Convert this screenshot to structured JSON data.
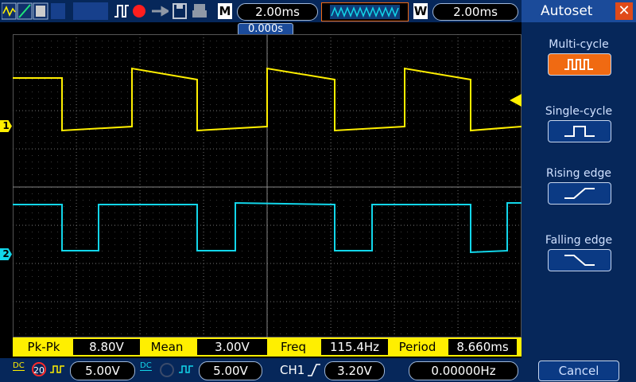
{
  "topbar": {
    "timebase_tag": "M",
    "timebase": "2.00ms",
    "window_tag": "W",
    "window": "2.00ms",
    "trigger_offset": "0.000s"
  },
  "channels": {
    "ch1_marker": "1",
    "ch2_marker": "2"
  },
  "panel": {
    "title": "Autoset",
    "close_glyph": "✕",
    "modes": [
      {
        "label": "Multi-cycle"
      },
      {
        "label": "Single-cycle"
      },
      {
        "label": "Rising edge"
      },
      {
        "label": "Falling edge"
      }
    ],
    "cancel": "Cancel"
  },
  "measurements": {
    "pkpk_label": "Pk-Pk",
    "pkpk_value": "8.80V",
    "mean_label": "Mean",
    "mean_value": "3.00V",
    "freq_label": "Freq",
    "freq_value": "115.4Hz",
    "period_label": "Period",
    "period_value": "8.660ms"
  },
  "bottombar": {
    "ch1_coupling": "DC",
    "ch1_bw": "20",
    "ch1_scale": "5.00V",
    "ch2_coupling": "DC",
    "ch2_scale": "5.00V",
    "trigger_source": "CH1",
    "trigger_level": "3.20V",
    "trigger_freq": "0.00000Hz"
  },
  "colors": {
    "ch1": "#ffef00",
    "ch2": "#12d6ea",
    "panel_bg": "#06275a",
    "active_button": "#f06a12",
    "close_button": "#e04a1a"
  }
}
